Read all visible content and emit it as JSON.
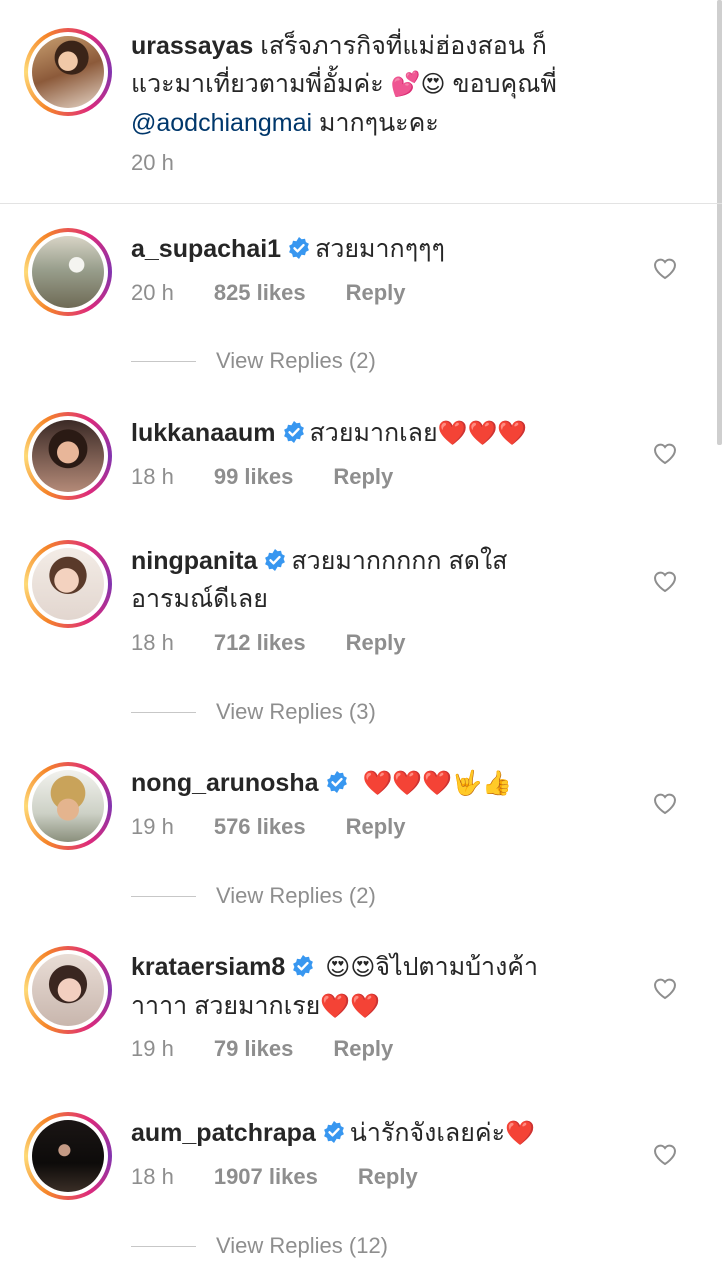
{
  "caption": {
    "username": "urassayas",
    "line1": "เสร็จภารกิจที่แม่ฮ่องสอน ก็",
    "line2_text": "แวะมาเที่ยวตามพี่อั้มค่ะ",
    "line2_emoji": "💕😍",
    "line2_tail": "ขอบคุณพี่",
    "mention": "@aodchiangmai",
    "line3_tail": "มากๆนะคะ",
    "time": "20 h"
  },
  "comments": [
    {
      "username": "a_supachai1",
      "text": "สวยมากๆๆๆ",
      "time": "20 h",
      "likes": "825 likes",
      "reply": "Reply",
      "view_replies": "View Replies (2)"
    },
    {
      "username": "lukkanaaum",
      "text": "สวยมากเลย",
      "emoji": "❤️❤️❤️",
      "time": "18 h",
      "likes": "99 likes",
      "reply": "Reply"
    },
    {
      "username": "ningpanita",
      "text": "สวยมากกกกก สดใส",
      "text2": "อารมณ์ดีเลย",
      "time": "18 h",
      "likes": "712 likes",
      "reply": "Reply",
      "view_replies": "View Replies (3)"
    },
    {
      "username": "nong_arunosha",
      "emoji": "❤️❤️❤️🤟👍",
      "time": "19 h",
      "likes": "576 likes",
      "reply": "Reply",
      "view_replies": "View Replies (2)"
    },
    {
      "username": "krataersiam8",
      "emoji": "😍😍",
      "text": "จิไปตามบ้างค้า",
      "text2": "าาาา สวยมากเรย",
      "emoji2": "❤️❤️",
      "time": "19 h",
      "likes": "79 likes",
      "reply": "Reply"
    },
    {
      "username": "aum_patchrapa",
      "text": "น่ารักจังเลยค่ะ",
      "emoji": "❤️",
      "time": "18 h",
      "likes": "1907 likes",
      "reply": "Reply",
      "view_replies": "View Replies (12)"
    }
  ],
  "icons": {
    "verified": "verified-badge-icon",
    "like": "heart-outline-icon"
  },
  "colors": {
    "username": "#262626",
    "meta": "#8e8e8e",
    "mention": "#00376b",
    "verified": "#3897f0"
  }
}
